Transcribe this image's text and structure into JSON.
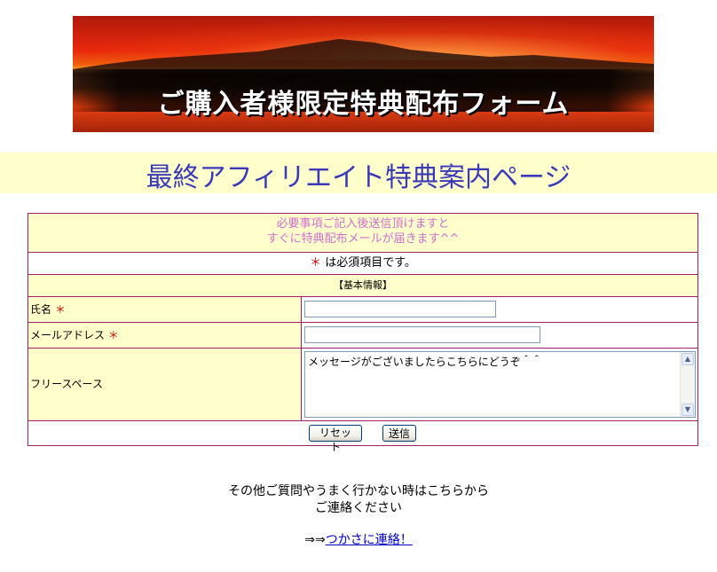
{
  "banner": {
    "title": "ご購入者様限定特典配布フォーム"
  },
  "heading": "最終アフィリエイト特典案内ページ",
  "form": {
    "notice_line1": "必要事項ご記入後送信頂けますと",
    "notice_line2": "すぐに特典配布メールが届きます^^",
    "required_star": "＊",
    "required_text": "は必須項目です。",
    "section_title": "【基本情報】",
    "fields": {
      "name_label": "氏名",
      "email_label": "メールアドレス",
      "free_label": "フリースペース",
      "star": "＊",
      "name_value": "",
      "email_value": "",
      "free_value": "メッセージがございましたらこちらにどうぞ＾＾"
    },
    "buttons": {
      "reset": "リセット",
      "submit": "送信"
    }
  },
  "footer": {
    "line1": "その他ご質問やうまく行かない時はこちらから",
    "line2": "ご連絡ください",
    "contact_prefix": "⇒⇒",
    "contact_link": "つかさに連絡！"
  },
  "colors": {
    "heading": "#3a3ab8",
    "notice": "#d070d0",
    "border": "#a0206a",
    "highlight": "#ffffcc",
    "link": "#0000cc"
  }
}
